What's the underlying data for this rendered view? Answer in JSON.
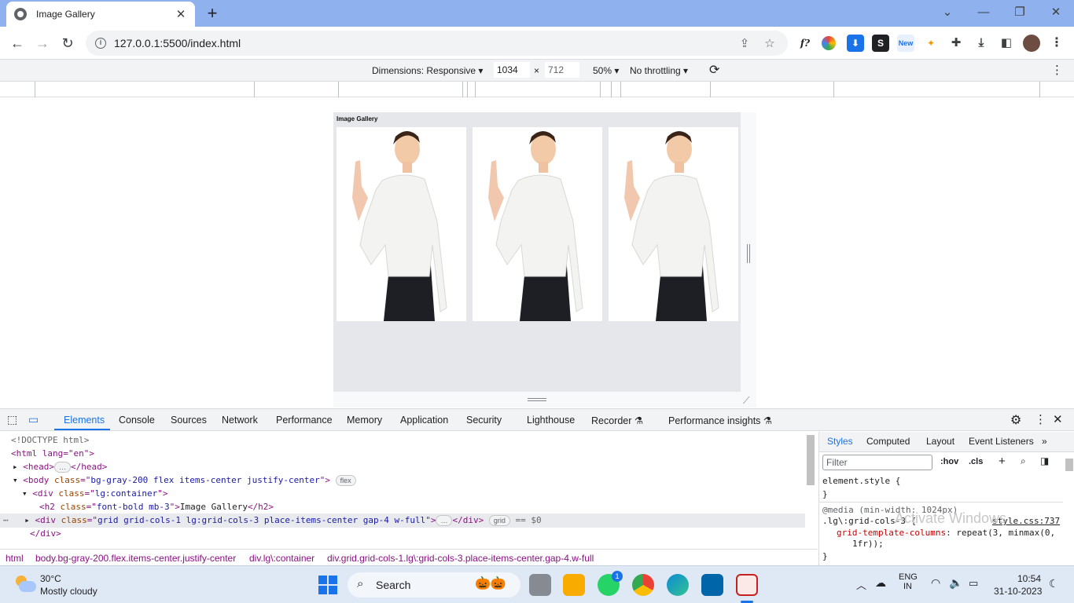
{
  "browser": {
    "tab_title": "Image Gallery",
    "tab_close": "✕",
    "new_tab": "+",
    "url": "127.0.0.1:5500/index.html",
    "window_controls": [
      "⌄",
      "—",
      "❐",
      "✕"
    ]
  },
  "device_toolbar": {
    "dimensions_label": "Dimensions: Responsive",
    "width": "1034",
    "times": "×",
    "height": "712",
    "zoom": "50%",
    "throttling": "No throttling"
  },
  "page": {
    "heading": "Image Gallery",
    "images": [
      {
        "name": "gallery-image-1",
        "alt": "Woman pointing up"
      },
      {
        "name": "gallery-image-2",
        "alt": "Woman pointing up"
      },
      {
        "name": "gallery-image-3",
        "alt": "Woman pointing up"
      }
    ]
  },
  "devtools": {
    "tabs": [
      "Elements",
      "Console",
      "Sources",
      "Network",
      "Performance",
      "Memory",
      "Application",
      "Security",
      "Lighthouse",
      "Recorder",
      "Performance insights"
    ],
    "active_tab": "Elements",
    "dom": {
      "doctype": "<!DOCTYPE html>",
      "html_open": "<html lang=\"en\">",
      "head": "<head>",
      "head_close": "</head>",
      "body_tag": "body",
      "body_class_attr": "class",
      "body_class": "bg-gray-200 flex items-center justify-center",
      "body_badge": "flex",
      "div_tag": "div",
      "div_class": "lg:container",
      "h2_class": "font-bold mb-3",
      "h2_text": "Image Gallery",
      "grid_class": "grid grid-cols-1 lg:grid-cols-3 place-items-center gap-4 w-full",
      "grid_badge": "grid",
      "selected_marker": "== $0",
      "div_close": "</div>",
      "ellipsis": "…"
    },
    "breadcrumbs": [
      "html",
      "body.bg-gray-200.flex.items-center.justify-center",
      "div.lg\\:container",
      "div.grid.grid-cols-1.lg\\:grid-cols-3.place-items-center.gap-4.w-full"
    ],
    "styles_tabs": [
      "Styles",
      "Computed",
      "Layout",
      "Event Listeners"
    ],
    "filter_placeholder": "Filter",
    "hov": ":hov",
    "cls": ".cls",
    "css": {
      "element_style": "element.style {",
      "close_brace": "}",
      "media": "@media (min-width: 1024px)",
      "selector": ".lg\\:grid-cols-3 {",
      "source": "style.css:737",
      "prop": "grid-template-columns",
      "value": "repeat(3, minmax(0,",
      "value2": "1fr));",
      "watermark": "Activate Windows"
    }
  },
  "taskbar": {
    "temp": "30°C",
    "weather": "Mostly cloudy",
    "search": "Search",
    "lang1": "ENG",
    "lang2": "IN",
    "time": "10:54",
    "date": "31-10-2023",
    "whatsapp_badge": "1"
  }
}
